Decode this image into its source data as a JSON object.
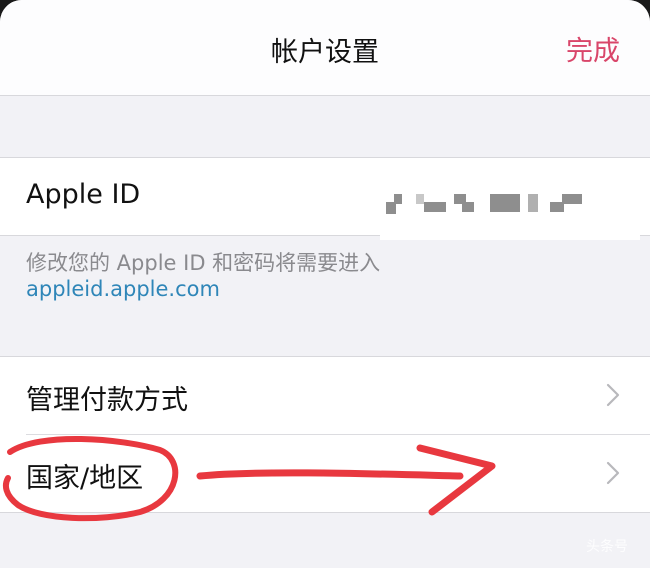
{
  "nav": {
    "title": "帐户设置",
    "done_label": "完成",
    "accent_color": "#d9466a"
  },
  "apple_id_group": {
    "label": "Apple ID",
    "value_redacted": true
  },
  "footer": {
    "note": "修改您的 Apple ID 和密码将需要进入",
    "link": "appleid.apple.com",
    "link_color": "#2f86b8"
  },
  "settings_group": {
    "items": [
      {
        "label": "管理付款方式",
        "icon": "chevron-right-icon"
      },
      {
        "label": "国家/地区",
        "icon": "chevron-right-icon",
        "annotated": true
      }
    ]
  },
  "annotation": {
    "color": "#e8383f",
    "shapes": [
      "circle-around-country-region",
      "arrow-pointing-right"
    ]
  },
  "watermark": {
    "text": "头条号"
  }
}
